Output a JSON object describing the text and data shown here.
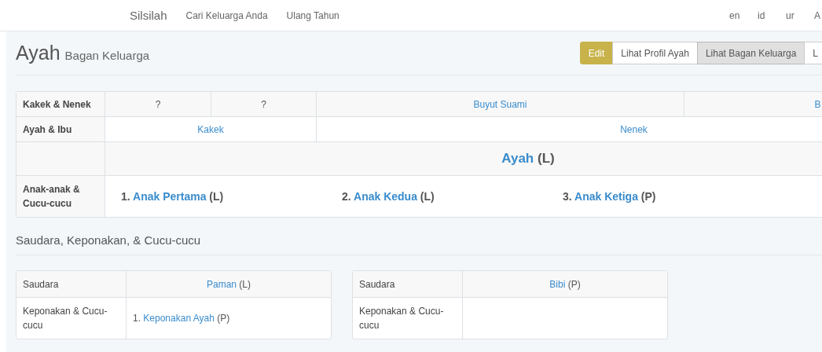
{
  "nav": {
    "brand": "Silsilah",
    "links": [
      "Cari Keluarga Anda",
      "Ulang Tahun"
    ],
    "languages": [
      "en",
      "id",
      "ur",
      "A"
    ]
  },
  "header": {
    "title": "Ayah",
    "subtitle": "Bagan Keluarga",
    "buttons": [
      {
        "label": "Edit",
        "kind": "edit",
        "selected": false
      },
      {
        "label": "Lihat Profil Ayah",
        "kind": "default",
        "selected": false
      },
      {
        "label": "Lihat Bagan Keluarga",
        "kind": "default",
        "selected": true
      },
      {
        "label": "L",
        "kind": "default",
        "selected": false
      }
    ]
  },
  "family_chart": {
    "rows": [
      {
        "kind": "grandparents",
        "label": "Kakek & Nenek",
        "cells": [
          {
            "text": "?",
            "link": false
          },
          {
            "text": "?",
            "link": false
          },
          {
            "text": "Buyut Suami",
            "link": true
          },
          {
            "text": "B",
            "link": true
          }
        ]
      },
      {
        "kind": "parents",
        "label": "Ayah & Ibu",
        "cells": [
          {
            "text": "Kakek",
            "link": true
          },
          {
            "text": "Nenek",
            "link": true
          }
        ]
      },
      {
        "kind": "self",
        "person": {
          "name": "Ayah",
          "gender": "(L)"
        }
      },
      {
        "kind": "children",
        "label": "Anak-anak & Cucu-cucu",
        "children": [
          {
            "number": "1.",
            "name": "Anak Pertama",
            "gender": "(L)"
          },
          {
            "number": "2.",
            "name": "Anak Kedua",
            "gender": "(L)"
          },
          {
            "number": "3.",
            "name": "Anak Ketiga",
            "gender": "(P)"
          }
        ]
      }
    ]
  },
  "siblings": {
    "title": "Saudara, Keponakan, & Cucu-cucu",
    "tables": [
      {
        "header_label": "Saudara",
        "person": {
          "name": "Paman",
          "gender": "(L)"
        },
        "row_label": "Keponakan & Cucu-cucu",
        "children": [
          {
            "number": "1.",
            "name": "Keponakan Ayah",
            "gender": "(P)"
          }
        ]
      },
      {
        "header_label": "Saudara",
        "person": {
          "name": "Bibi",
          "gender": "(P)"
        },
        "row_label": "Keponakan & Cucu-cucu"
      }
    ]
  }
}
